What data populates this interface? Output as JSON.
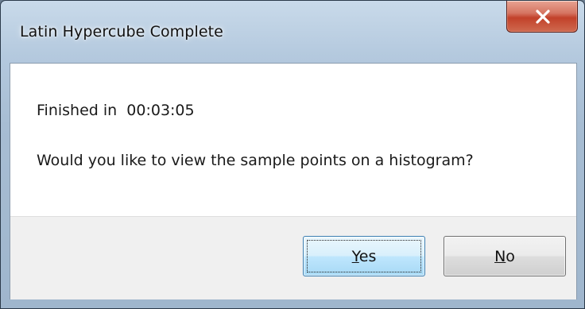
{
  "window": {
    "title": "Latin Hypercube Complete"
  },
  "message": {
    "finished_label": "Finished in  00:03:05",
    "question": "Would you like to view the sample points on a histogram?"
  },
  "buttons": {
    "yes": {
      "mnemonic": "Y",
      "rest": "es"
    },
    "no": {
      "mnemonic": "N",
      "rest": "o"
    }
  },
  "icons": {
    "close": "close-icon"
  },
  "colors": {
    "close_button": "#c2412a",
    "default_button_border": "#3c7fb1",
    "button_area": "#f0f0f0"
  }
}
